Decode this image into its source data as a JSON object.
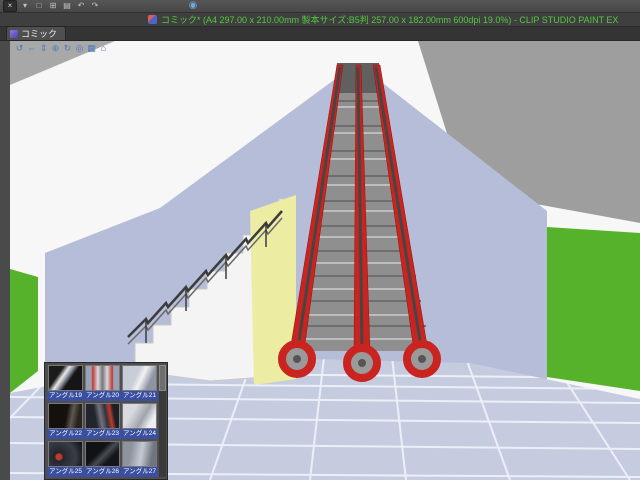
{
  "window": {
    "title": "コミック* (A4 297.00 x 210.00mm 製本サイズ:B5判 257.00 x 182.00mm 600dpi 19.0%) - CLIP STUDIO PAINT EX",
    "tab_label": "コミック"
  },
  "toolbar_top": {
    "icons": [
      {
        "name": "close",
        "glyph": "×"
      },
      {
        "name": "collapse",
        "glyph": "▾"
      },
      {
        "name": "new-document",
        "glyph": "□"
      },
      {
        "name": "open-document",
        "glyph": "⊞"
      },
      {
        "name": "save-document",
        "glyph": "▤"
      },
      {
        "name": "undo",
        "glyph": "↶"
      },
      {
        "name": "redo",
        "glyph": "↷"
      },
      {
        "name": "clip-studio-sphere",
        "glyph": "◉"
      }
    ]
  },
  "toolbar_3d": {
    "icons": [
      {
        "name": "camera-rotate",
        "glyph": "↺"
      },
      {
        "name": "camera-pan",
        "glyph": "⇔"
      },
      {
        "name": "camera-dolly",
        "glyph": "⇕"
      },
      {
        "name": "camera-zoom",
        "glyph": "⊕"
      },
      {
        "name": "object-rotate",
        "glyph": "↻"
      },
      {
        "name": "object-move",
        "glyph": "◎"
      },
      {
        "name": "snap-grid",
        "glyph": "▦"
      },
      {
        "name": "reset-view",
        "glyph": "⌂"
      }
    ]
  },
  "angle_palette": {
    "labels": [
      "アングル19",
      "アングル20",
      "アングル21",
      "アングル22",
      "アングル23",
      "アングル24",
      "アングル25",
      "アングル26",
      "アングル27"
    ]
  },
  "colors": {
    "wall_green": "#55b22a",
    "wall_lavender": "#b5bdd8",
    "stair_wall_yellow": "#eceda2",
    "escalator_red": "#c9241f",
    "floor": "#c6cce0",
    "ceiling_gray": "#9e9e9e",
    "title_text": "#52c93f",
    "angle_label_blue": "#3b4fa0"
  }
}
